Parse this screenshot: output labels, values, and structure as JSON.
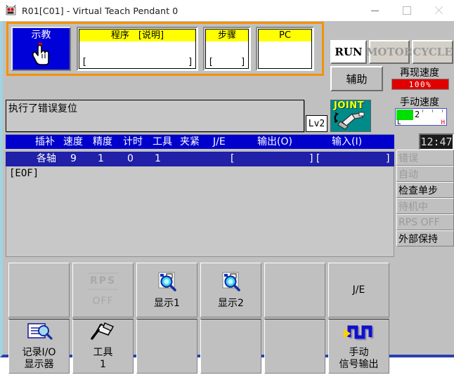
{
  "window": {
    "title": "R01[C01] - Virtual Teach Pendant 0",
    "app_icon": "robot-icon",
    "minimize_label": "—",
    "maximize_label": "□",
    "close_label": "✕"
  },
  "toolbar": {
    "teach_button": {
      "label": "示教",
      "icon": "pointing-hand-icon",
      "active": true,
      "bg_color": "#0000d8"
    },
    "fields": [
      {
        "title": "程序　[说明]",
        "value": "",
        "open_bracket": "[",
        "close_bracket": "]"
      },
      {
        "title": "步骤",
        "value": "",
        "open_bracket": "[",
        "close_bracket": "]"
      },
      {
        "title": "PC",
        "value": "",
        "open_bracket": "",
        "close_bracket": ""
      }
    ],
    "frame_color": "#f2920a"
  },
  "mode_buttons": [
    {
      "label": "RUN",
      "enabled": true
    },
    {
      "label": "MOTOR",
      "enabled": false
    },
    {
      "label": "CYCLE",
      "enabled": false
    }
  ],
  "aux_button": {
    "label": "辅助"
  },
  "speeds": {
    "playback": {
      "label": "再现速度",
      "value": "100%",
      "bar_color": "#e00000"
    },
    "manual": {
      "label": "手动速度",
      "value": "2",
      "low": "L",
      "high": "H",
      "bar_color": "#00e000",
      "level": 2,
      "max_level": 5
    }
  },
  "message": {
    "text": "执行了错误复位",
    "level_badge": "Lv2"
  },
  "joint_icon": {
    "label": "JOINT",
    "bg_color": "#008b8b",
    "text_color": "#ffff00"
  },
  "clock": {
    "time": "12:47"
  },
  "program_table": {
    "headers": [
      "插补",
      "速度",
      "精度",
      "计时",
      "工具",
      "夹紧",
      "J/E",
      "输出(O)",
      "输入(I)"
    ],
    "row": {
      "interp": "各轴",
      "speed": "9",
      "accuracy": "1",
      "timer": "0",
      "tool": "1",
      "clamp": "",
      "je": "",
      "output_open": "[",
      "output_close": "]",
      "input_open": "[",
      "input_close": "]"
    },
    "body_text": "[EOF]"
  },
  "status_list": [
    {
      "label": "错误",
      "active": false
    },
    {
      "label": "自动",
      "active": false
    },
    {
      "label": "检查单步",
      "active": true
    },
    {
      "label": "待机中",
      "active": false
    },
    {
      "label": "RPS OFF",
      "active": false
    },
    {
      "label": "外部保持",
      "active": true
    }
  ],
  "function_keys": [
    {
      "top": {
        "label": "",
        "icon": "",
        "enabled": true
      },
      "bottom": {
        "label": "记录I/O",
        "label2": "显示器",
        "icon": "document-search-icon",
        "enabled": true
      }
    },
    {
      "top": {
        "label": "RPS",
        "label2": "OFF",
        "icon": "rps-text-icon",
        "enabled": false
      },
      "bottom": {
        "label": "工具",
        "label2": "1",
        "icon": "tool-icon",
        "enabled": true
      }
    },
    {
      "top": {
        "label": "显示1",
        "icon": "page-search-icon",
        "enabled": true
      },
      "bottom": {
        "label": "",
        "icon": "",
        "enabled": true
      }
    },
    {
      "top": {
        "label": "显示2",
        "icon": "page-search-icon",
        "enabled": true
      },
      "bottom": {
        "label": "",
        "icon": "",
        "enabled": true
      }
    },
    {
      "top": {
        "label": "",
        "icon": "",
        "enabled": true
      },
      "bottom": {
        "label": "",
        "icon": "",
        "enabled": true
      }
    },
    {
      "top": {
        "label": "J/E",
        "icon": "",
        "enabled": true
      },
      "bottom": {
        "label": "手动",
        "label2": "信号输出",
        "icon": "signal-wave-icon",
        "enabled": true
      }
    }
  ],
  "colors": {
    "panel_bg": "#c0c0c0",
    "header_blue": "#0000cc",
    "row_blue": "#2020a8",
    "field_title_yellow": "#ffff00",
    "accent_orange": "#f2920a"
  }
}
